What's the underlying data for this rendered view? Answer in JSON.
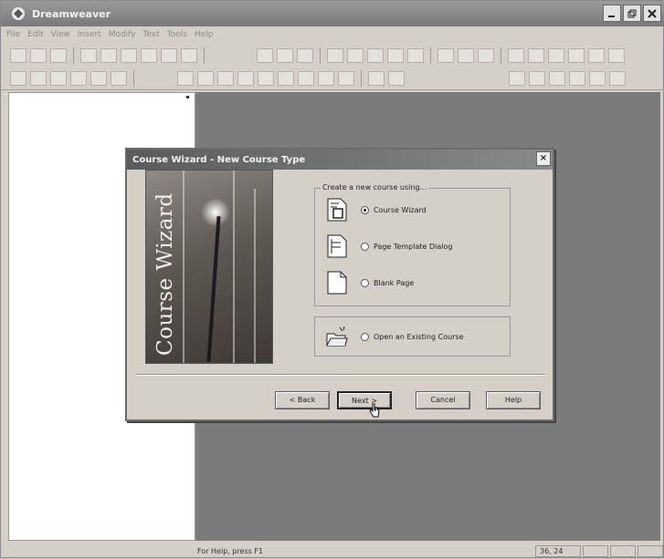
{
  "app": {
    "title": "Dreamweaver",
    "menu": [
      "File",
      "Edit",
      "View",
      "Insert",
      "Modify",
      "Text",
      "Tools",
      "Help"
    ]
  },
  "status": {
    "help_text": "For Help, press F1",
    "position": "36, 24"
  },
  "dialog": {
    "title": "Course Wizard - New Course Type",
    "close_glyph": "×",
    "image_text": "Course Wizard",
    "group_label": "Create a new course using...",
    "options": [
      {
        "label": "Course Wizard",
        "selected": true,
        "icon": "wizard-page-icon"
      },
      {
        "label": "Page Template Dialog",
        "selected": false,
        "icon": "template-page-icon"
      },
      {
        "label": "Blank Page",
        "selected": false,
        "icon": "blank-page-icon"
      }
    ],
    "open_existing": {
      "label": "Open an Existing Course",
      "selected": false,
      "icon": "open-folder-icon"
    },
    "buttons": {
      "back": "< Back",
      "next": "Next >",
      "cancel": "Cancel",
      "help": "Help"
    }
  },
  "colors": {
    "workspace": "#7b7b7b",
    "chrome": "#d4d0c8",
    "titlebar": "#7a7a7a"
  }
}
